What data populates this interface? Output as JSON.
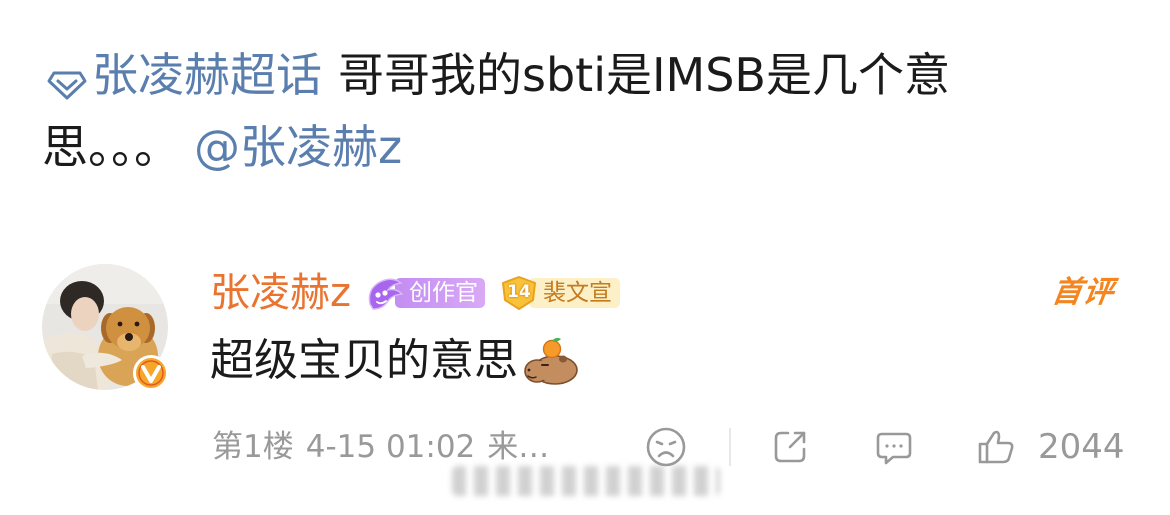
{
  "post": {
    "topic_icon": "super-topic-diamond-icon",
    "topic": "张凌赫超话",
    "text_line1": "哥哥我的sbti是IMSB是几个意",
    "text_line2": "思。。。",
    "mention": "@张凌赫z"
  },
  "comment": {
    "avatar_icon": "user-avatar",
    "verified_icon": "verified-v-icon",
    "username": "张凌赫z",
    "badges": [
      {
        "icon": "creator-quill-icon",
        "label": "创作官"
      },
      {
        "icon": "fan-level-shield-icon",
        "level": "14",
        "label": "裴文宣"
      }
    ],
    "first_comment_tag": "首评",
    "text": "超级宝贝的意思",
    "emoji": "capybara-with-orange-emoji",
    "floor": "第1楼",
    "time": "4-15 01:02",
    "source": "来…",
    "actions": {
      "dislike_icon": "sad-face-icon",
      "share_icon": "share-icon",
      "reply_icon": "comment-bubble-icon",
      "like_icon": "thumbs-up-icon",
      "like_count": "2044"
    }
  },
  "colors": {
    "link": "#5a7eae",
    "username": "#eb7330",
    "text": "#1b1b1b",
    "meta": "#999999",
    "first_comment": "#f4851f",
    "creator_badge": "#c38df2",
    "fan_badge_bg": "#fdf0c6",
    "fan_badge_text": "#c47a1d"
  }
}
